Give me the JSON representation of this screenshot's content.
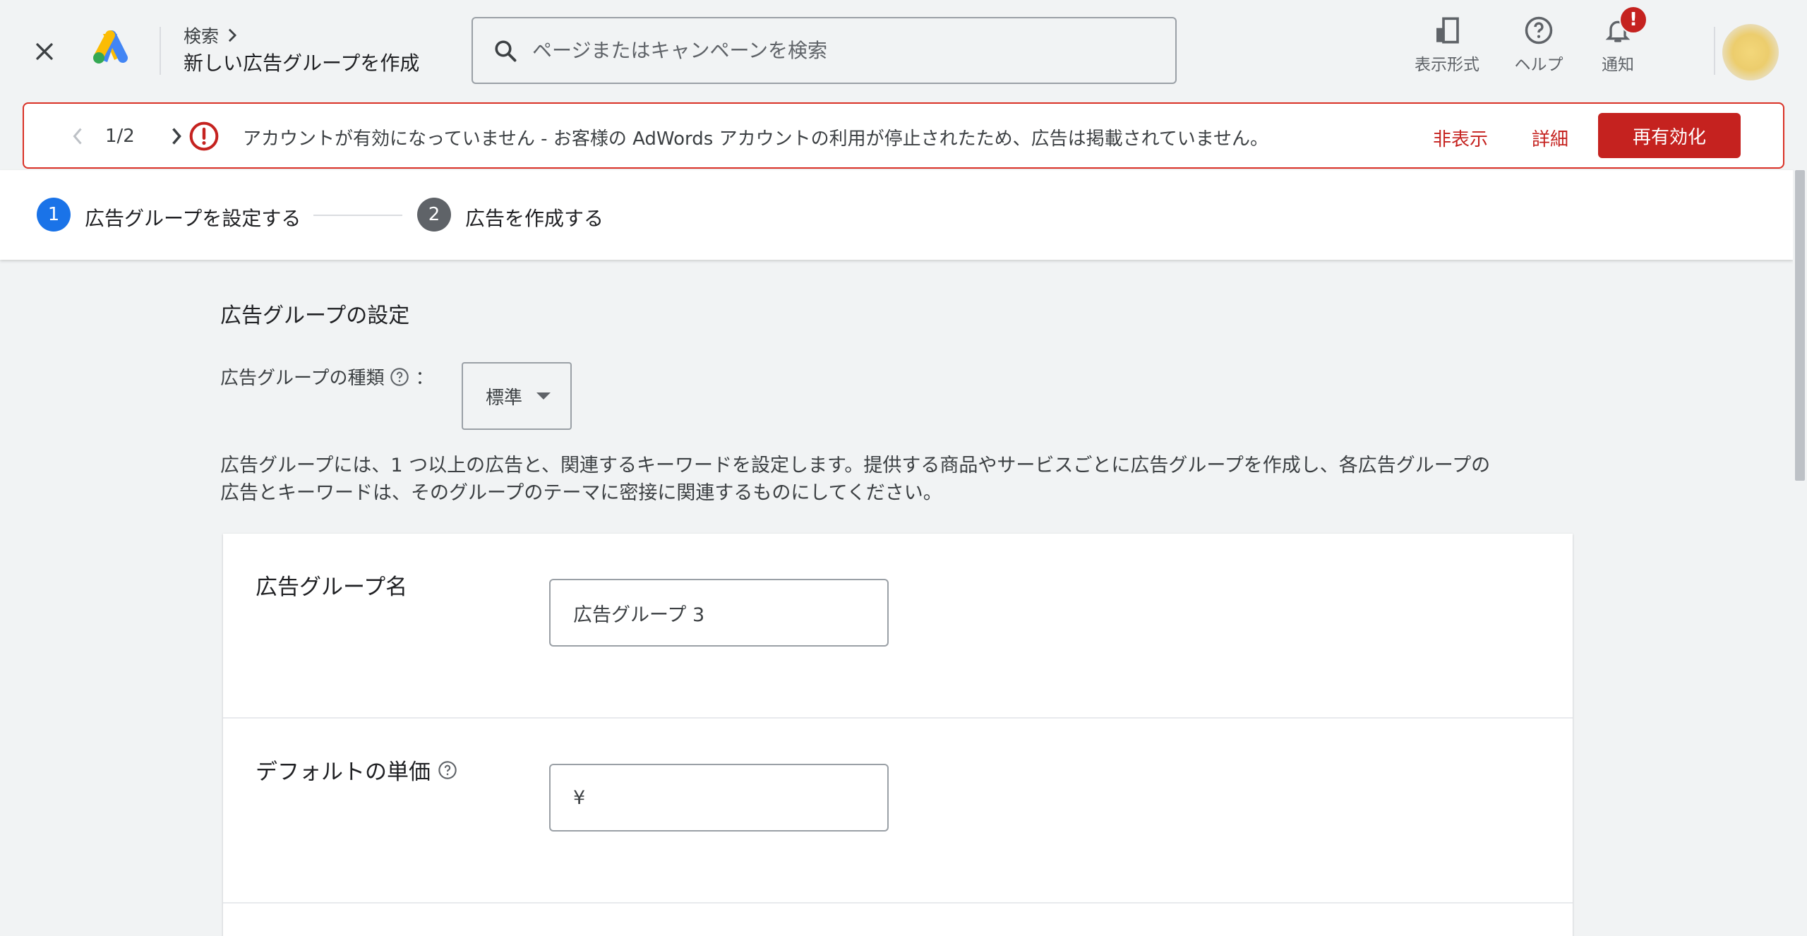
{
  "header": {
    "breadcrumb": "検索",
    "title": "新しい広告グループを作成",
    "search_placeholder": "ページまたはキャンペーンを検索",
    "tools": [
      {
        "icon": "appearance-icon",
        "label": "表示形式"
      },
      {
        "icon": "help-icon",
        "label": "ヘルプ"
      },
      {
        "icon": "bell-icon",
        "label": "通知"
      }
    ],
    "notification_badge": "!"
  },
  "alert": {
    "pager": "1/2",
    "message": "アカウントが有効になっていません - お客様の AdWords アカウントの利用が停止されたため、広告は掲載されていません。",
    "dismiss": "非表示",
    "details": "詳細",
    "reactivate": "再有効化"
  },
  "stepper": {
    "steps": [
      {
        "number": "1",
        "label": "広告グループを設定する",
        "active": true
      },
      {
        "number": "2",
        "label": "広告を作成する",
        "active": false
      }
    ]
  },
  "settings": {
    "section_title": "広告グループの設定",
    "type_label": "広告グループの種類",
    "type_colon": "：",
    "type_value": "標準",
    "description_line1": "広告グループには、1 つ以上の広告と、関連するキーワードを設定します。提供する商品やサービスごとに広告グループを作成し、各広告グループの",
    "description_line2": "広告とキーワードは、そのグループのテーマに密接に関連するものにしてください。"
  },
  "form": {
    "name_label": "広告グループ名",
    "name_value": "広告グループ 3",
    "bid_label": "デフォルトの単価",
    "bid_currency": "¥",
    "bid_value": ""
  },
  "colors": {
    "primary_blue": "#1a73e8",
    "error_red": "#c5221f",
    "step_inactive": "#5f6368"
  }
}
